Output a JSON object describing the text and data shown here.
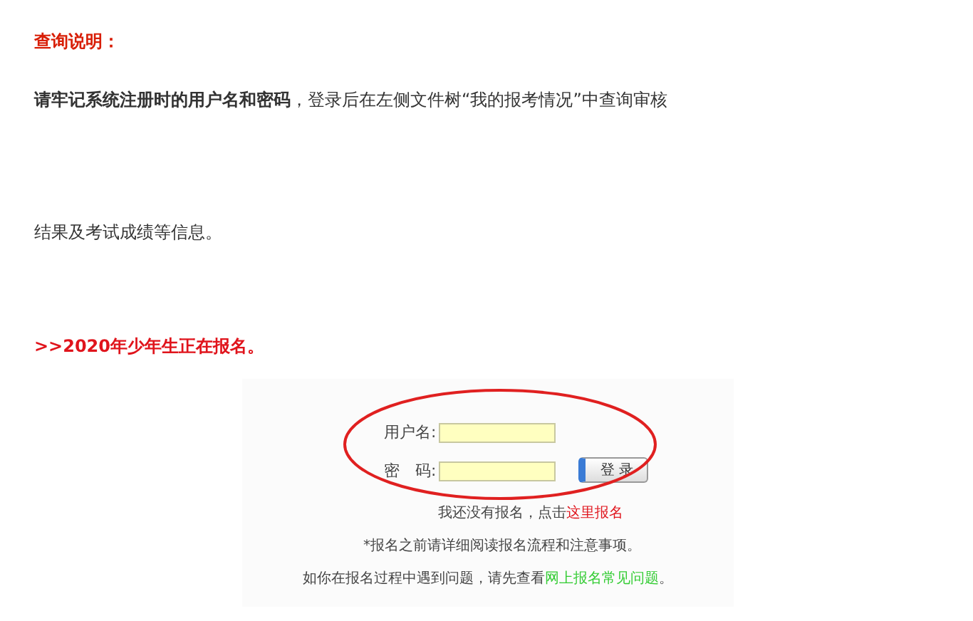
{
  "heading": "查询说明：",
  "intro": [
    "**请牢记系统注册时的用户名和密码**，登录后在左侧文件树“我的报考情况”中查询审核",
    "结果及考试成绩等信息。"
  ],
  "notice": ">>2020年少年生正在报名。",
  "login": {
    "fields": [
      {
        "label": "用户名:"
      },
      {
        "label": "密　码:"
      }
    ],
    "button": "登 录",
    "register": {
      "text": "我还没有报名，点击",
      "link": "这里报名"
    },
    "note": "*报名之前请详细阅读报名流程和注意事项。",
    "help": {
      "text": "如你在报名过程中遇到问题，请先查看",
      "link": "网上报名常见问题",
      "suffix": "。"
    },
    "highlight": {
      "kind": "ellipse"
    }
  }
}
